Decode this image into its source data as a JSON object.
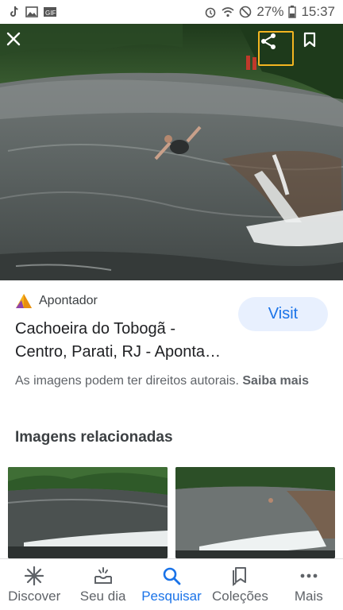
{
  "status_bar": {
    "battery_percent": "27%",
    "time": "15:37"
  },
  "hero": {
    "close_icon": "close-icon",
    "share_icon": "share-icon",
    "bookmark_icon": "bookmark-icon"
  },
  "result": {
    "source_name": "Apontador",
    "visit_label": "Visit",
    "title_line1": "Cachoeira do Tobogã -",
    "title_line2": "Centro, Parati, RJ - Aponta…",
    "copyright_text": "As imagens podem ter direitos autorais.",
    "learn_more": "Saiba mais"
  },
  "related": {
    "heading": "Imagens relacionadas"
  },
  "bottom_nav": {
    "items": [
      {
        "label": "Discover",
        "icon": "asterisk-icon",
        "active": false
      },
      {
        "label": "Seu dia",
        "icon": "inbox-icon",
        "active": false
      },
      {
        "label": "Pesquisar",
        "icon": "search-icon",
        "active": true
      },
      {
        "label": "Coleções",
        "icon": "collections-icon",
        "active": false
      },
      {
        "label": "Mais",
        "icon": "more-icon",
        "active": false
      }
    ]
  },
  "colors": {
    "accent": "#1a73e8",
    "visit_bg": "#e8f0fe",
    "share_highlight": "#f3b521"
  }
}
